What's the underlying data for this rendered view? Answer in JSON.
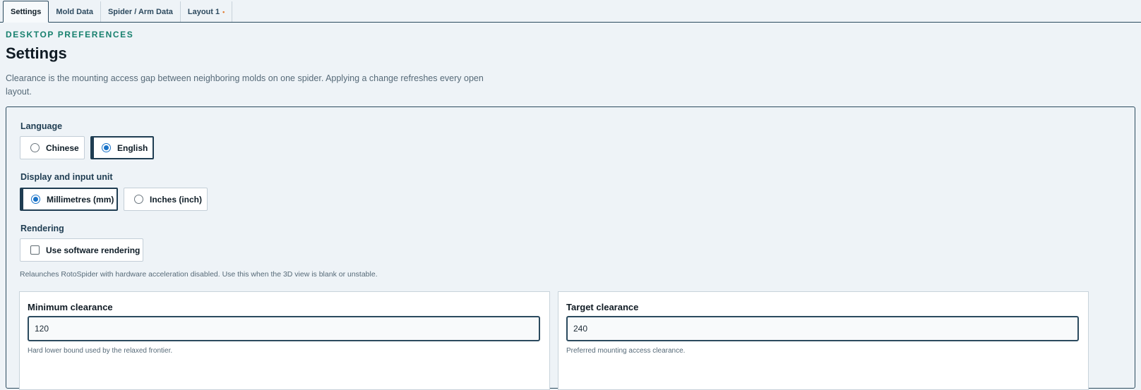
{
  "tabs": [
    {
      "label": "Settings",
      "active": true
    },
    {
      "label": "Mold Data"
    },
    {
      "label": "Spider / Arm Data"
    },
    {
      "label": "Layout 1",
      "unsaved_dot": "•"
    }
  ],
  "header": {
    "eyebrow": "DESKTOP PREFERENCES",
    "title": "Settings",
    "intro": "Clearance is the mounting access gap between neighboring molds on one spider. Applying a change refreshes every open layout."
  },
  "language": {
    "label": "Language",
    "options": [
      {
        "label": "Chinese",
        "selected": false
      },
      {
        "label": "English",
        "selected": true
      }
    ]
  },
  "units": {
    "label": "Display and input unit",
    "options": [
      {
        "label": "Millimetres (mm)",
        "selected": true
      },
      {
        "label": "Inches (inch)",
        "selected": false
      }
    ]
  },
  "rendering": {
    "label": "Rendering",
    "checkbox_label": "Use software rendering",
    "checked": false,
    "help": "Relaunches RotoSpider with hardware acceleration disabled. Use this when the 3D view is blank or unstable."
  },
  "clearance": {
    "minimum": {
      "title": "Minimum clearance",
      "value": "120",
      "help": "Hard lower bound used by the relaxed frontier."
    },
    "target": {
      "title": "Target clearance",
      "value": "240",
      "help": "Preferred mounting access clearance."
    }
  },
  "colors": {
    "accent": "#1f3d52",
    "eyebrow": "#17806e",
    "unsaved": "#e07b2f",
    "radio": "#1a73c8"
  }
}
